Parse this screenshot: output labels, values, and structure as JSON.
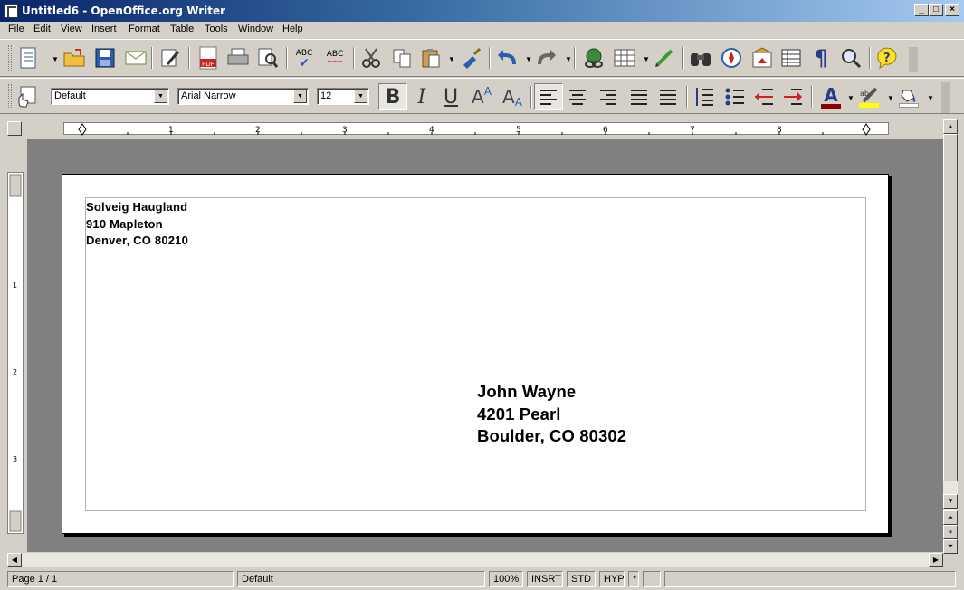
{
  "window": {
    "title": "Untitled6 - OpenOffice.org Writer"
  },
  "menu": [
    "File",
    "Edit",
    "View",
    "Insert",
    "Format",
    "Table",
    "Tools",
    "Window",
    "Help"
  ],
  "toolbar": {
    "style_value": "Default",
    "font_value": "Arial Narrow",
    "size_value": "12",
    "spellcheck_label": "ABC",
    "autospell_label": "ABC",
    "pdf_label": "PDF"
  },
  "ruler": {
    "marks": [
      "1",
      "2",
      "3",
      "4",
      "5",
      "6",
      "7",
      "8"
    ],
    "vmarks": [
      "1",
      "2",
      "3"
    ]
  },
  "document": {
    "sender": [
      "Solveig Haugland",
      "910 Mapleton",
      "Denver, CO 80210"
    ],
    "recipient": [
      "John Wayne",
      "4201 Pearl",
      "Boulder, CO 80302"
    ]
  },
  "status": {
    "page": "Page 1 / 1",
    "style": "Default",
    "zoom": "100%",
    "insert_mode": "INSRT",
    "selection_mode": "STD",
    "hyperlink_mode": "HYP",
    "modified": "*"
  }
}
